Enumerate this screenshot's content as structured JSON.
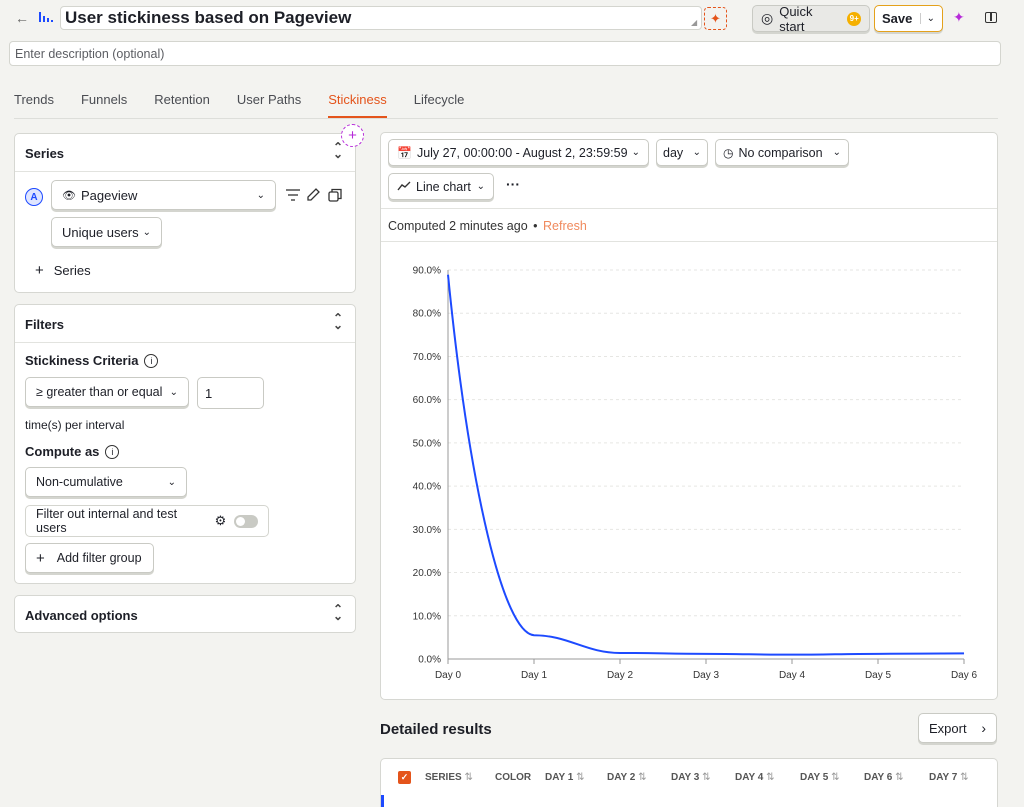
{
  "header": {
    "title": "User stickiness based on Pageview",
    "description_placeholder": "Enter description (optional)",
    "quick_start_label": "Quick start",
    "quick_start_badge": "9+",
    "save_label": "Save"
  },
  "tabs": [
    {
      "label": "Trends"
    },
    {
      "label": "Funnels"
    },
    {
      "label": "Retention"
    },
    {
      "label": "User Paths"
    },
    {
      "label": "Stickiness",
      "active": true
    },
    {
      "label": "Lifecycle"
    }
  ],
  "series_panel": {
    "title": "Series",
    "series_letter": "A",
    "event": "Pageview",
    "aggregation": "Unique users",
    "add_series_label": "Series"
  },
  "filters_panel": {
    "title": "Filters",
    "criteria_label": "Stickiness Criteria",
    "operator": "≥ greater than or equal",
    "value": "1",
    "interval_text": "time(s) per interval",
    "compute_label": "Compute as",
    "compute_value": "Non-cumulative",
    "filter_internal_label": "Filter out internal and test users",
    "add_filter_group_label": "Add filter group"
  },
  "advanced_panel": {
    "title": "Advanced options"
  },
  "controls": {
    "date_range": "July 27, 00:00:00 - August 2, 23:59:59",
    "interval": "day",
    "comparison": "No comparison",
    "chart_type": "Line chart",
    "more": "···"
  },
  "status": {
    "computed": "Computed 2 minutes ago",
    "bullet": "•",
    "refresh": "Refresh"
  },
  "chart_data": {
    "type": "line",
    "categories": [
      "Day 0",
      "Day 1",
      "Day 2",
      "Day 3",
      "Day 4",
      "Day 5",
      "Day 6"
    ],
    "series": [
      {
        "values": [
          88.9,
          5.5,
          1.4,
          1.2,
          1.0,
          1.2,
          1.3
        ]
      }
    ],
    "ylim": [
      0,
      90
    ],
    "yticks": [
      "0.0%",
      "10.0%",
      "20.0%",
      "30.0%",
      "40.0%",
      "50.0%",
      "60.0%",
      "70.0%",
      "80.0%",
      "90.0%"
    ],
    "line_color": "#1d4aff",
    "grid": true
  },
  "results": {
    "title": "Detailed results",
    "export_label": "Export",
    "columns": [
      "SERIES",
      "COLOR",
      "DAY 1",
      "DAY 2",
      "DAY 3",
      "DAY 4",
      "DAY 5",
      "DAY 6",
      "DAY 7"
    ]
  },
  "colors": {
    "accent": "#e4541b",
    "purple": "#b62ad9",
    "chart_line": "#1d4aff",
    "badge": "#f5b000"
  }
}
